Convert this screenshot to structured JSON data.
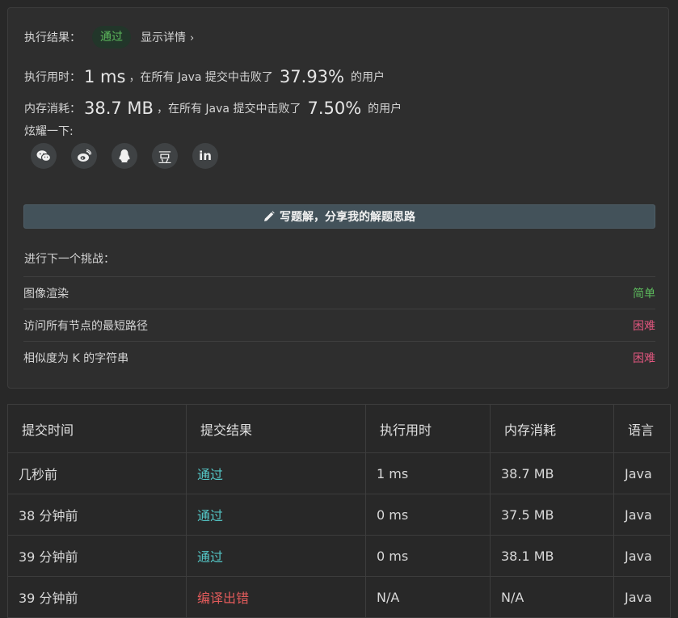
{
  "result": {
    "label": "执行结果：",
    "status": "通过",
    "details": "显示详情",
    "details_chevron": "›"
  },
  "runtime": {
    "label": "执行用时：",
    "value": "1 ms",
    "middle": "，在所有 Java 提交中击败了",
    "percent": "37.93%",
    "suffix": "的用户"
  },
  "memory": {
    "label": "内存消耗：",
    "value": "38.7 MB",
    "middle": "，在所有 Java 提交中击败了",
    "percent": "7.50%",
    "suffix": "的用户"
  },
  "share": {
    "label": "炫耀一下:",
    "icons": [
      "wechat-icon",
      "weibo-icon",
      "qq-icon",
      "douban-icon",
      "linkedin-icon"
    ],
    "douban_glyph": "豆",
    "linkedin_glyph": "in"
  },
  "write_solution": {
    "label": "写题解，分享我的解题思路",
    "icon": "pencil-icon"
  },
  "next": {
    "label": "进行下一个挑战：",
    "items": [
      {
        "title": "图像渲染",
        "difficulty": "简单",
        "level": "easy"
      },
      {
        "title": "访问所有节点的最短路径",
        "difficulty": "困难",
        "level": "hard"
      },
      {
        "title": "相似度为 K 的字符串",
        "difficulty": "困难",
        "level": "hard"
      }
    ]
  },
  "submissions": {
    "headers": [
      "提交时间",
      "提交结果",
      "执行用时",
      "内存消耗",
      "语言"
    ],
    "rows": [
      [
        "几秒前",
        "通过",
        "1 ms",
        "38.7 MB",
        "Java"
      ],
      [
        "38 分钟前",
        "通过",
        "0 ms",
        "37.5 MB",
        "Java"
      ],
      [
        "39 分钟前",
        "通过",
        "0 ms",
        "38.1 MB",
        "Java"
      ],
      [
        "39 分钟前",
        "编译出错",
        "N/A",
        "N/A",
        "Java"
      ]
    ]
  },
  "colors": {
    "accepted": "#54c6c6",
    "compile_error": "#e25b5b",
    "easy": "#5cb85c",
    "hard": "#e0567e"
  }
}
